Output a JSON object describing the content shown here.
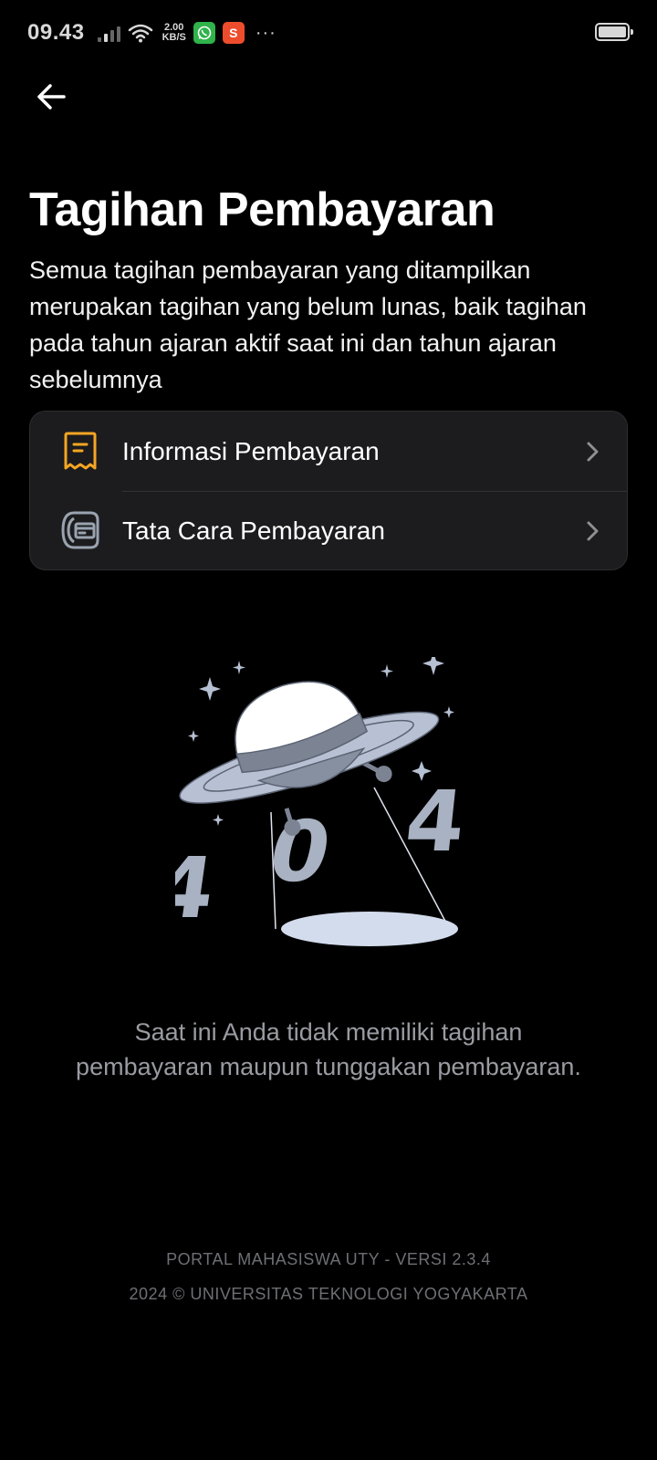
{
  "status_bar": {
    "time": "09.43",
    "net_speed_value": "2.00",
    "net_speed_unit": "KB/S",
    "shopee_glyph": "S",
    "overflow": "···"
  },
  "header": {
    "title": "Tagihan Pembayaran",
    "description": "Semua tagihan pembayaran yang ditampilkan merupakan tagihan yang belum lunas, baik tagihan pada tahun ajaran aktif saat ini dan tahun ajaran sebelumnya"
  },
  "menu": {
    "items": [
      {
        "label": "Informasi Pembayaran",
        "icon": "receipt-icon",
        "icon_color": "#f5a623"
      },
      {
        "label": "Tata Cara Pembayaran",
        "icon": "payment-card-icon",
        "icon_color": "#9aa3b0"
      }
    ]
  },
  "empty_state": {
    "digit_left": "4",
    "digit_middle": "0",
    "digit_right": "4",
    "message": "Saat ini Anda tidak memiliki tagihan pembayaran maupun tunggakan pembayaran."
  },
  "footer": {
    "version": "PORTAL MAHASISWA UTY - VERSI 2.3.4",
    "copyright": "2024 © UNIVERSITAS TEKNOLOGI YOGYAKARTA"
  },
  "colors": {
    "background": "#000000",
    "card": "#1c1c1e",
    "accent_orange": "#f5a623",
    "muted_text": "#9a9ba2"
  }
}
